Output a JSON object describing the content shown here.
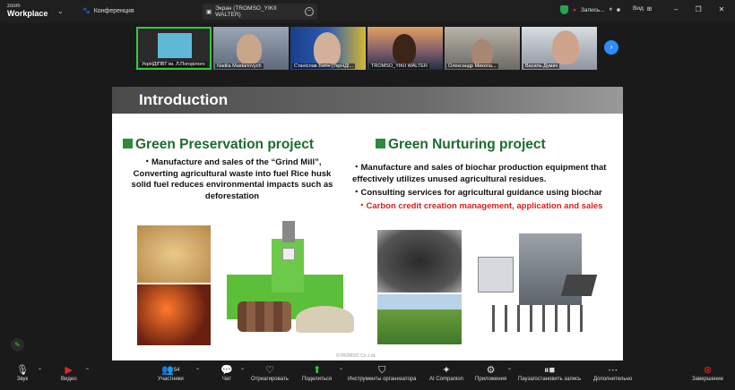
{
  "app": {
    "logo_small": "zoom",
    "logo_big": "Workplace",
    "conference_label": "Конференция",
    "screen_tab": "Экран (TROMSO_YIKII WALTER)",
    "recording": "Запись...",
    "view": "Вид"
  },
  "participants": [
    {
      "label": "УкрНДІПВТ ім. Л.Погорілого"
    },
    {
      "label": "Nadiia Maidanovych"
    },
    {
      "label": "Станіслав Батін [УкрНДІ..."
    },
    {
      "label": "TROMSO_YIKII WALTER"
    },
    {
      "label": "Олександр Микола..."
    },
    {
      "label": "Василь Думич"
    }
  ],
  "slide": {
    "title": "Introduction",
    "left_heading": "Green Preservation project",
    "left_text": "・Manufacture and sales of the “Grind Mill”, Converting agricultural waste into fuel Rice husk solid fuel reduces environmental impacts such as deforestation",
    "right_heading": "Green Nurturing project",
    "right_line1": "・Manufacture and sales of biochar production equipment that effectively utilizes unused agricultural residues.",
    "right_line2": "・Consulting services for agricultural guidance using biochar",
    "right_line3": "・Carbon credit creation management, application and sales",
    "copyright": "©TROMSO Co.,Ltd."
  },
  "toolbar": {
    "audio": "Звук",
    "video": "Видео",
    "participants": "Участники",
    "participants_count": "54",
    "chat": "Чат",
    "react": "Отреагировать",
    "share": "Поделиться",
    "host_tools": "Инструменты организатора",
    "ai": "AI Companion",
    "apps": "Приложения",
    "pause_rec": "Пауза/остановить запись",
    "more": "Дополнительно",
    "end": "Завершение"
  },
  "colors": {
    "accent": "#2d8cff",
    "active_border": "#2ecc40",
    "heading_green": "#1f6b2e",
    "red_text": "#d62020",
    "end_red": "#e02828"
  }
}
